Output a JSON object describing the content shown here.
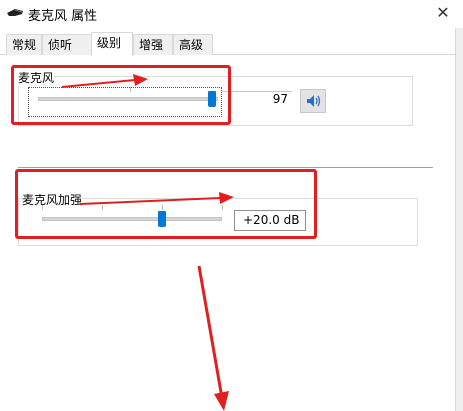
{
  "window": {
    "title": "麦克风 属性",
    "close_glyph": "✕"
  },
  "tabs": [
    {
      "label": "常规",
      "active": false
    },
    {
      "label": "侦听",
      "active": false
    },
    {
      "label": "级别",
      "active": true
    },
    {
      "label": "增强",
      "active": false
    },
    {
      "label": "高级",
      "active": false
    }
  ],
  "microphone": {
    "label": "麦克风",
    "level": 97,
    "value_text": "97",
    "speaker_icon": "speaker-icon"
  },
  "boost": {
    "label": "麦克风加强",
    "value_text": "+20.0 dB",
    "level_fraction": 0.667
  },
  "annotations": {
    "color": "#e02020"
  }
}
